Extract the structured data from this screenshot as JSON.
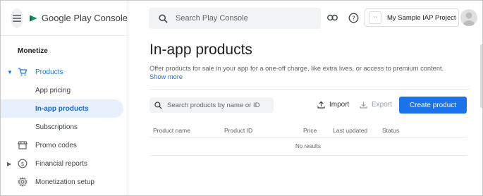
{
  "app": {
    "brand_name": "Google Play Console"
  },
  "sidebar": {
    "section_title": "Monetize",
    "items": [
      {
        "label": "Products",
        "icon": "cart-icon"
      },
      {
        "label": "App pricing"
      },
      {
        "label": "In-app products"
      },
      {
        "label": "Subscriptions"
      },
      {
        "label": "Promo codes",
        "icon": "store-icon"
      },
      {
        "label": "Financial reports",
        "icon": "dollar-circle-icon"
      },
      {
        "label": "Monetization setup",
        "icon": "gear-icon"
      }
    ]
  },
  "topbar": {
    "search_placeholder": "Search Play Console",
    "project_name": "My Sample IAP Project"
  },
  "main": {
    "title": "In-app products",
    "description": "Offer products for sale in your app for a one-off charge, like extra lives, or access to premium content.",
    "show_more": "Show more",
    "product_search_placeholder": "Search products by name or ID",
    "import_label": "Import",
    "export_label": "Export",
    "create_label": "Create product",
    "columns": [
      "Product name",
      "Product ID",
      "Price",
      "Last updated",
      "Status"
    ],
    "empty_text": "No results"
  },
  "colors": {
    "accent": "#1a73e8",
    "selected_bg": "#e8f0fe"
  }
}
